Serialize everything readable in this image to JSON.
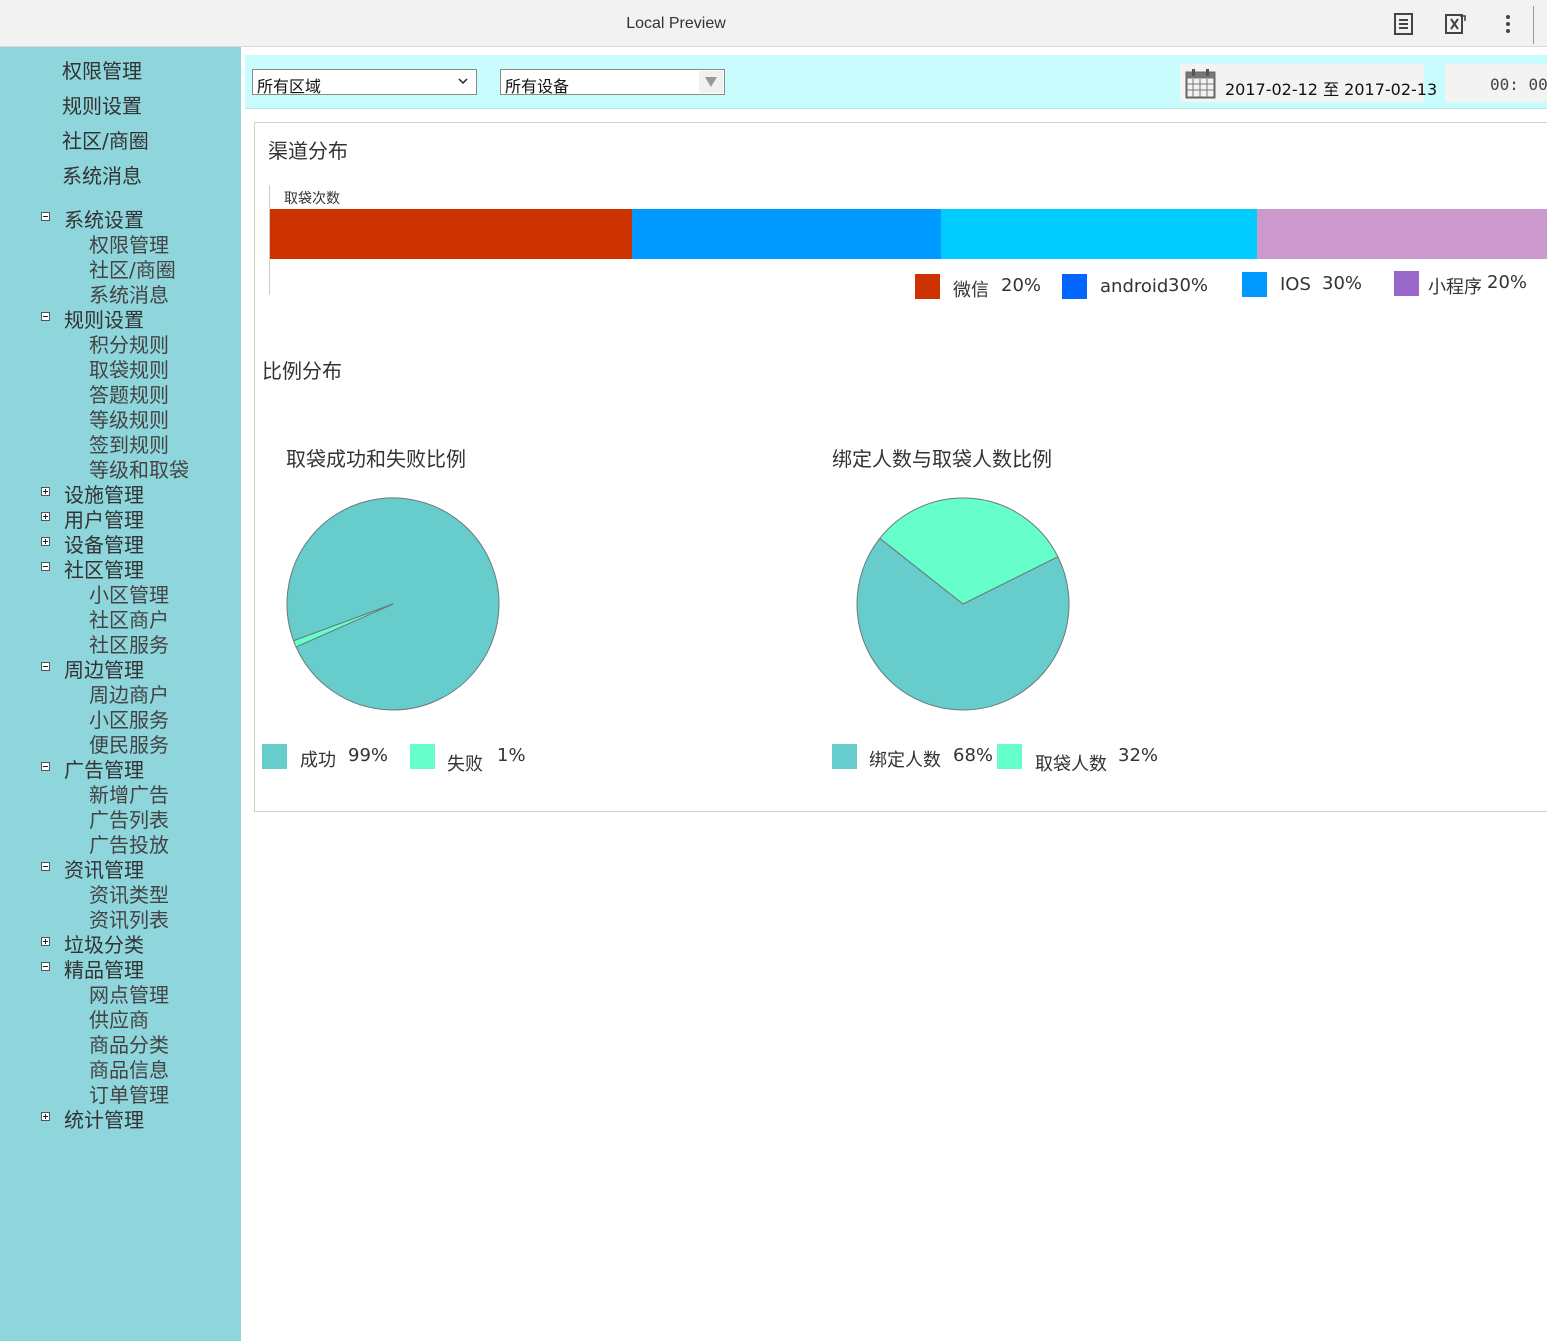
{
  "window": {
    "title": "Local Preview",
    "icons": [
      "document-icon",
      "excel-export-icon",
      "more-vertical-icon"
    ]
  },
  "sidebar": {
    "top_links": [
      "权限管理",
      "规则设置",
      "社区/商圈",
      "系统消息"
    ],
    "tree": [
      {
        "label": "系统设置",
        "expanded": true,
        "children": [
          "权限管理",
          "社区/商圈",
          "系统消息"
        ]
      },
      {
        "label": "规则设置",
        "expanded": true,
        "children": [
          "积分规则",
          "取袋规则",
          "答题规则",
          "等级规则",
          "签到规则",
          "等级和取袋"
        ]
      },
      {
        "label": "设施管理",
        "expanded": false,
        "children": []
      },
      {
        "label": "用户管理",
        "expanded": false,
        "children": []
      },
      {
        "label": "设备管理",
        "expanded": false,
        "children": []
      },
      {
        "label": "社区管理",
        "expanded": true,
        "children": [
          "小区管理",
          "社区商户",
          "社区服务"
        ]
      },
      {
        "label": "周边管理",
        "expanded": true,
        "children": [
          "周边商户",
          "小区服务",
          "便民服务"
        ]
      },
      {
        "label": "广告管理",
        "expanded": true,
        "children": [
          "新增广告",
          "广告列表",
          "广告投放"
        ]
      },
      {
        "label": "资讯管理",
        "expanded": true,
        "children": [
          "资讯类型",
          "资讯列表"
        ]
      },
      {
        "label": "垃圾分类",
        "expanded": false,
        "children": []
      },
      {
        "label": "精品管理",
        "expanded": true,
        "children": [
          "网点管理",
          "供应商",
          "商品分类",
          "商品信息",
          "订单管理"
        ]
      },
      {
        "label": "统计管理",
        "expanded": false,
        "children": []
      }
    ]
  },
  "filters": {
    "region_value": "所有区域",
    "device_value": "所有设备",
    "date_range": "2017-02-12 至 2017-02-13",
    "time_value": "00: 00-"
  },
  "channel": {
    "section_title": "渠道分布",
    "chart_data": {
      "type": "bar",
      "ylabel": "取袋次数",
      "stacked": true,
      "orientation": "horizontal",
      "categories": [
        "微信",
        "android",
        "IOS",
        "小程序"
      ],
      "values": [
        20,
        30,
        30,
        20
      ],
      "value_labels": [
        "20%",
        "30%",
        "30%",
        "20%"
      ],
      "bar_colors": [
        "#cc3300",
        "#0099ff",
        "#00ccff",
        "#cc99cc"
      ],
      "legend_colors": [
        "#cc3300",
        "#0066ff",
        "#0099ff",
        "#9966cc"
      ],
      "legend": "bottom-right"
    }
  },
  "ratio": {
    "section_title": "比例分布",
    "charts": [
      {
        "title": "取袋成功和失败比例",
        "chart_data": {
          "type": "pie",
          "title": "取袋成功和失败比例",
          "categories": [
            "成功",
            "失败"
          ],
          "values": [
            99,
            1
          ],
          "value_labels": [
            "99%",
            "1%"
          ],
          "colors": [
            "#66cccc",
            "#66ffcc"
          ],
          "legend": "bottom-left"
        }
      },
      {
        "title": "绑定人数与取袋人数比例",
        "chart_data": {
          "type": "pie",
          "title": "绑定人数与取袋人数比例",
          "categories": [
            "绑定人数",
            "取袋人数"
          ],
          "values": [
            68,
            32
          ],
          "value_labels": [
            "68%",
            "32%"
          ],
          "colors": [
            "#66cccc",
            "#66ffcc"
          ],
          "legend": "bottom-left"
        }
      }
    ]
  }
}
